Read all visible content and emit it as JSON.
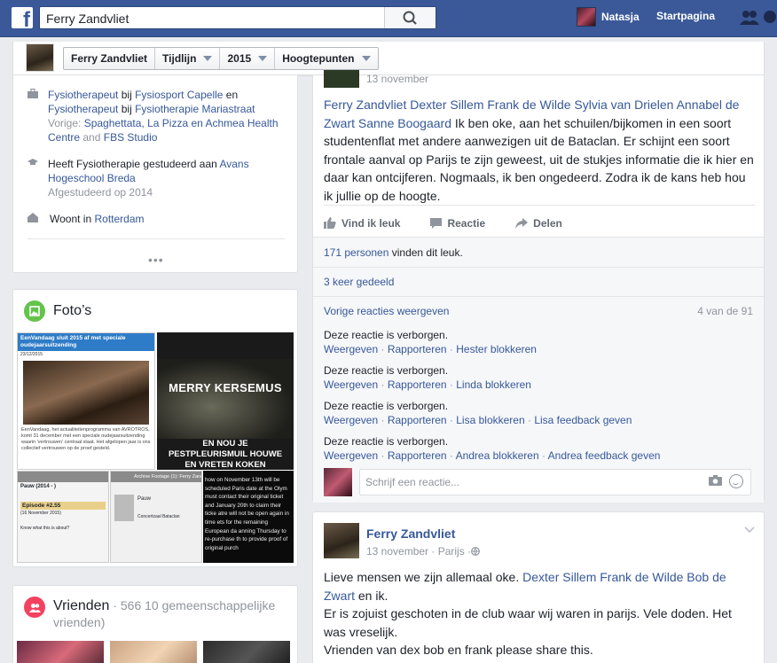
{
  "topbar": {
    "logo": "f",
    "search_value": "Ferry Zandvliet",
    "user_name": "Natasja",
    "home_label": "Startpagina"
  },
  "subbar": {
    "crumbs": [
      "Ferry Zandvliet",
      "Tijdlijn",
      "2015",
      "Hoogtepunten"
    ]
  },
  "intro": {
    "work_a": "Fysiotherapeut",
    "work_b": " bij ",
    "work_c": "Fysiosport Capelle",
    "work_d": " en ",
    "work_e": "Fysiotherapeut",
    "work_f": " bij ",
    "work_g": "Fysiotherapie Mariastraat",
    "prev_label": "Vorige: ",
    "prev_1": "Spaghettata, La Pizza en Achmea Health Centre",
    "prev_and": " and ",
    "prev_2": "FBS Studio",
    "edu_a": "Heeft Fysiotherapie gestudeerd aan ",
    "edu_b": "Avans Hogeschool Breda",
    "edu_c": "Afgestudeerd op 2014",
    "live_a": "Woont in ",
    "live_b": "Rotterdam",
    "more": "•••"
  },
  "photos": {
    "title": "Foto’s",
    "tile1_head": "EenVandaag sluit 2015 af met speciale oudejaarsuitzending",
    "tile1_date": "23/12/2015",
    "tile1_body": "EenVandaag, het actualiteitenprogramma van AVROTROS, komt 31 december met een speciale oudejaarsuitzending waarin 'vertrouwen' centraal staat. Het afgelopen jaar is ons collectief vertrouwen op de proef gesteld.",
    "tile2_top": "MERRY KERSEMUS",
    "tile2_bottom": "EN NOU JE PESTPLEURISMUIL HOUWE EN VRETEN KOKEN",
    "tile3_title": "Pauw (2014 - )",
    "tile3_ep": "Episode #2.55",
    "tile3_date": "(16 November 2015)",
    "tile3_q": "Know what this is about?",
    "tile4_title": "Archive Footage (1): Ferry Zandvl...",
    "tile4_show": "Pauw",
    "tile4_sub": "Concertzaal Bataclan",
    "tile5_text": "how on November 13th will be scheduled Paris date at the Olym must contact their original ticket and January 20th to claim their ticke atre will not be open again in time ets for the remaining European da anning Thursday to re-purchase th to provide proof of original purch"
  },
  "friends": {
    "title": "Vrienden",
    "count": " · 566 10 gemeenschappelijke vrienden)"
  },
  "post1": {
    "date": "13 november",
    "tags": "Ferry Zandvliet Dexter Sillem Frank de Wilde Sylvia van Drielen Annabel de Zwart Sanne Boogaard",
    "text": " Ik ben oke, aan het schuilen/bijkomen in een soort studentenflat met andere aanwezigen uit de Bataclan. Er schijnt een soort frontale aanval op Parijs te zijn geweest, uit de stukjes informatie die ik hier en daar kan ontcijferen. Nogmaals, ik ben ongedeerd. Zodra ik de kans heb hou ik jullie op de hoogte.",
    "like": "Vind ik leuk",
    "comment": "Reactie",
    "share": "Delen",
    "likes_count": "171 personen",
    "likes_rest": " vinden dit leuk.",
    "shares": "3 keer gedeeld",
    "prev_comments": "Vorige reacties weergeven",
    "comment_count": "4 van de 91",
    "hidden_text": "Deze reactie is verborgen.",
    "show": "Weergeven",
    "report": "Rapporteren",
    "block1": "Hester blokkeren",
    "block2": "Linda blokkeren",
    "block3": "Lisa blokkeren",
    "feedback3": "Lisa feedback geven",
    "block4": "Andrea blokkeren",
    "feedback4": "Andrea feedback geven",
    "reply_placeholder": "Schrijf een reactie..."
  },
  "post2": {
    "author": "Ferry Zandvliet",
    "meta": "13 november · Parijs · ",
    "line1a": "Lieve mensen we zijn allemaal oke. ",
    "line1b": "Dexter Sillem Frank de Wilde Bob de Zwart",
    "line1c": " en ik.",
    "line2": "Er is zojuist geschoten in de club waar wij waren in parijs. Vele doden. Het was vreselijk.",
    "line3": "Vrienden van dex bob en frank please share this."
  },
  "colors": {
    "brand": "#3b5998",
    "link": "#365899",
    "photos_icon": "#63c34b",
    "friends_icon": "#f3425f"
  }
}
